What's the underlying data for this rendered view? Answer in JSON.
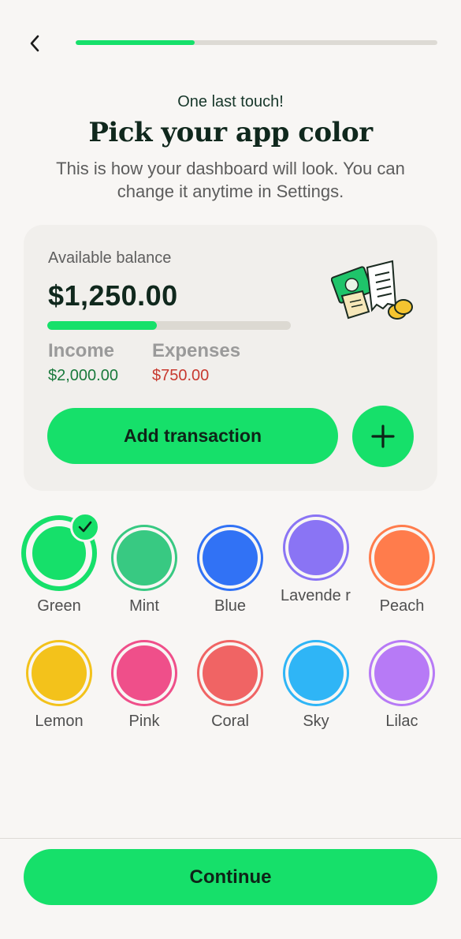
{
  "header": {
    "progress_fraction": 0.33,
    "eyebrow": "One last touch!",
    "title": "Pick your app color",
    "subtitle": "This is how your dashboard will look. You can change it anytime in Settings."
  },
  "preview_card": {
    "balance_label": "Available balance",
    "balance_amount": "$1,250.00",
    "balance_bar_fraction": 0.45,
    "income_label": "Income",
    "income_value": "$2,000.00",
    "expenses_label": "Expenses",
    "expenses_value": "$750.00",
    "add_transaction_label": "Add transaction",
    "plus_icon": "plus-icon",
    "illustration_icon": "money-receipt-icon"
  },
  "colors": {
    "selected": "Green",
    "options": [
      {
        "name": "Green",
        "hex": "#16e06a"
      },
      {
        "name": "Mint",
        "hex": "#38c982"
      },
      {
        "name": "Blue",
        "hex": "#3172f5"
      },
      {
        "name": "Lavender",
        "display": "Lavende r",
        "hex": "#8a74f4"
      },
      {
        "name": "Peach",
        "hex": "#ff7c4c"
      },
      {
        "name": "Lemon",
        "hex": "#f3c21b"
      },
      {
        "name": "Pink",
        "hex": "#ef4f8a"
      },
      {
        "name": "Coral",
        "hex": "#f06464"
      },
      {
        "name": "Sky",
        "hex": "#2fb5f6"
      },
      {
        "name": "Lilac",
        "hex": "#b77af6"
      }
    ]
  },
  "footer": {
    "continue_label": "Continue"
  }
}
